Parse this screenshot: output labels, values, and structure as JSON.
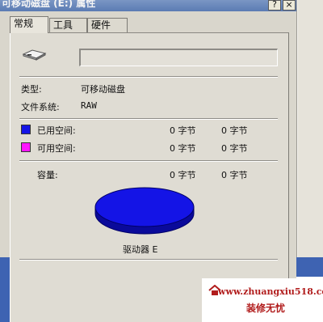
{
  "window": {
    "title": "可移动磁盘 (E:) 属性",
    "help_glyph": "?",
    "close_glyph": "×"
  },
  "tabs": [
    {
      "label": "常规",
      "selected": true
    },
    {
      "label": "工具",
      "selected": false
    },
    {
      "label": "硬件",
      "selected": false
    }
  ],
  "general": {
    "drive_icon": "removable-drive-icon",
    "name_value": "",
    "type_label": "类型:",
    "type_value": "可移动磁盘",
    "fs_label": "文件系统:",
    "fs_value": "RAW",
    "used_label": "已用空间:",
    "used_bytes": "0 字节",
    "used_size": "0 字节",
    "used_color": "#1414e6",
    "free_label": "可用空间:",
    "free_bytes": "0 字节",
    "free_size": "0 字节",
    "free_color": "#ff14ff",
    "capacity_label": "容量:",
    "capacity_bytes": "0 字节",
    "capacity_size": "0 字节",
    "pie_color": "#1414e6",
    "drive_label": "驱动器 E"
  },
  "watermark": {
    "url": "www.zhuangxiu518.com",
    "name": "装修无忧"
  }
}
